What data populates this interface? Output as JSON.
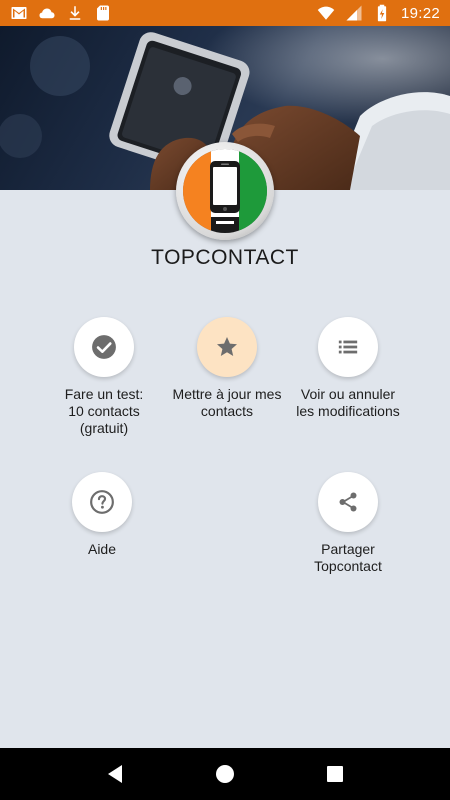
{
  "status_bar": {
    "time": "19:22",
    "left_icons": [
      "gmail-icon",
      "cloud-icon",
      "download-icon",
      "sd-card-icon"
    ],
    "right_icons": [
      "wifi-icon",
      "signal-icon",
      "battery-charging-icon"
    ]
  },
  "app": {
    "title": "TOPCONTACT"
  },
  "actions": [
    {
      "id": "test",
      "icon": "check-circle-icon",
      "label": "Fare un test:\n10 contacts\n(gratuit)",
      "highlight": false
    },
    {
      "id": "update",
      "icon": "star-icon",
      "label": "Mettre à jour mes\ncontacts",
      "highlight": true
    },
    {
      "id": "view",
      "icon": "list-icon",
      "label": "Voir ou annuler\nles modifications",
      "highlight": false
    },
    {
      "id": "help",
      "icon": "help-icon",
      "label": "Aide",
      "highlight": false
    },
    {
      "id": "share",
      "icon": "share-icon",
      "label": "Partager\nTopcontact",
      "highlight": false
    }
  ],
  "colors": {
    "status_bar": "#e07010",
    "background": "#e0e5ec",
    "highlight_circle": "#fde3c3",
    "icon_gray": "#6d6d6d",
    "flag_orange": "#f58220",
    "flag_green": "#1e9a3a"
  },
  "nav_bar": {
    "icons": [
      "back-icon",
      "home-icon",
      "recents-icon"
    ]
  }
}
